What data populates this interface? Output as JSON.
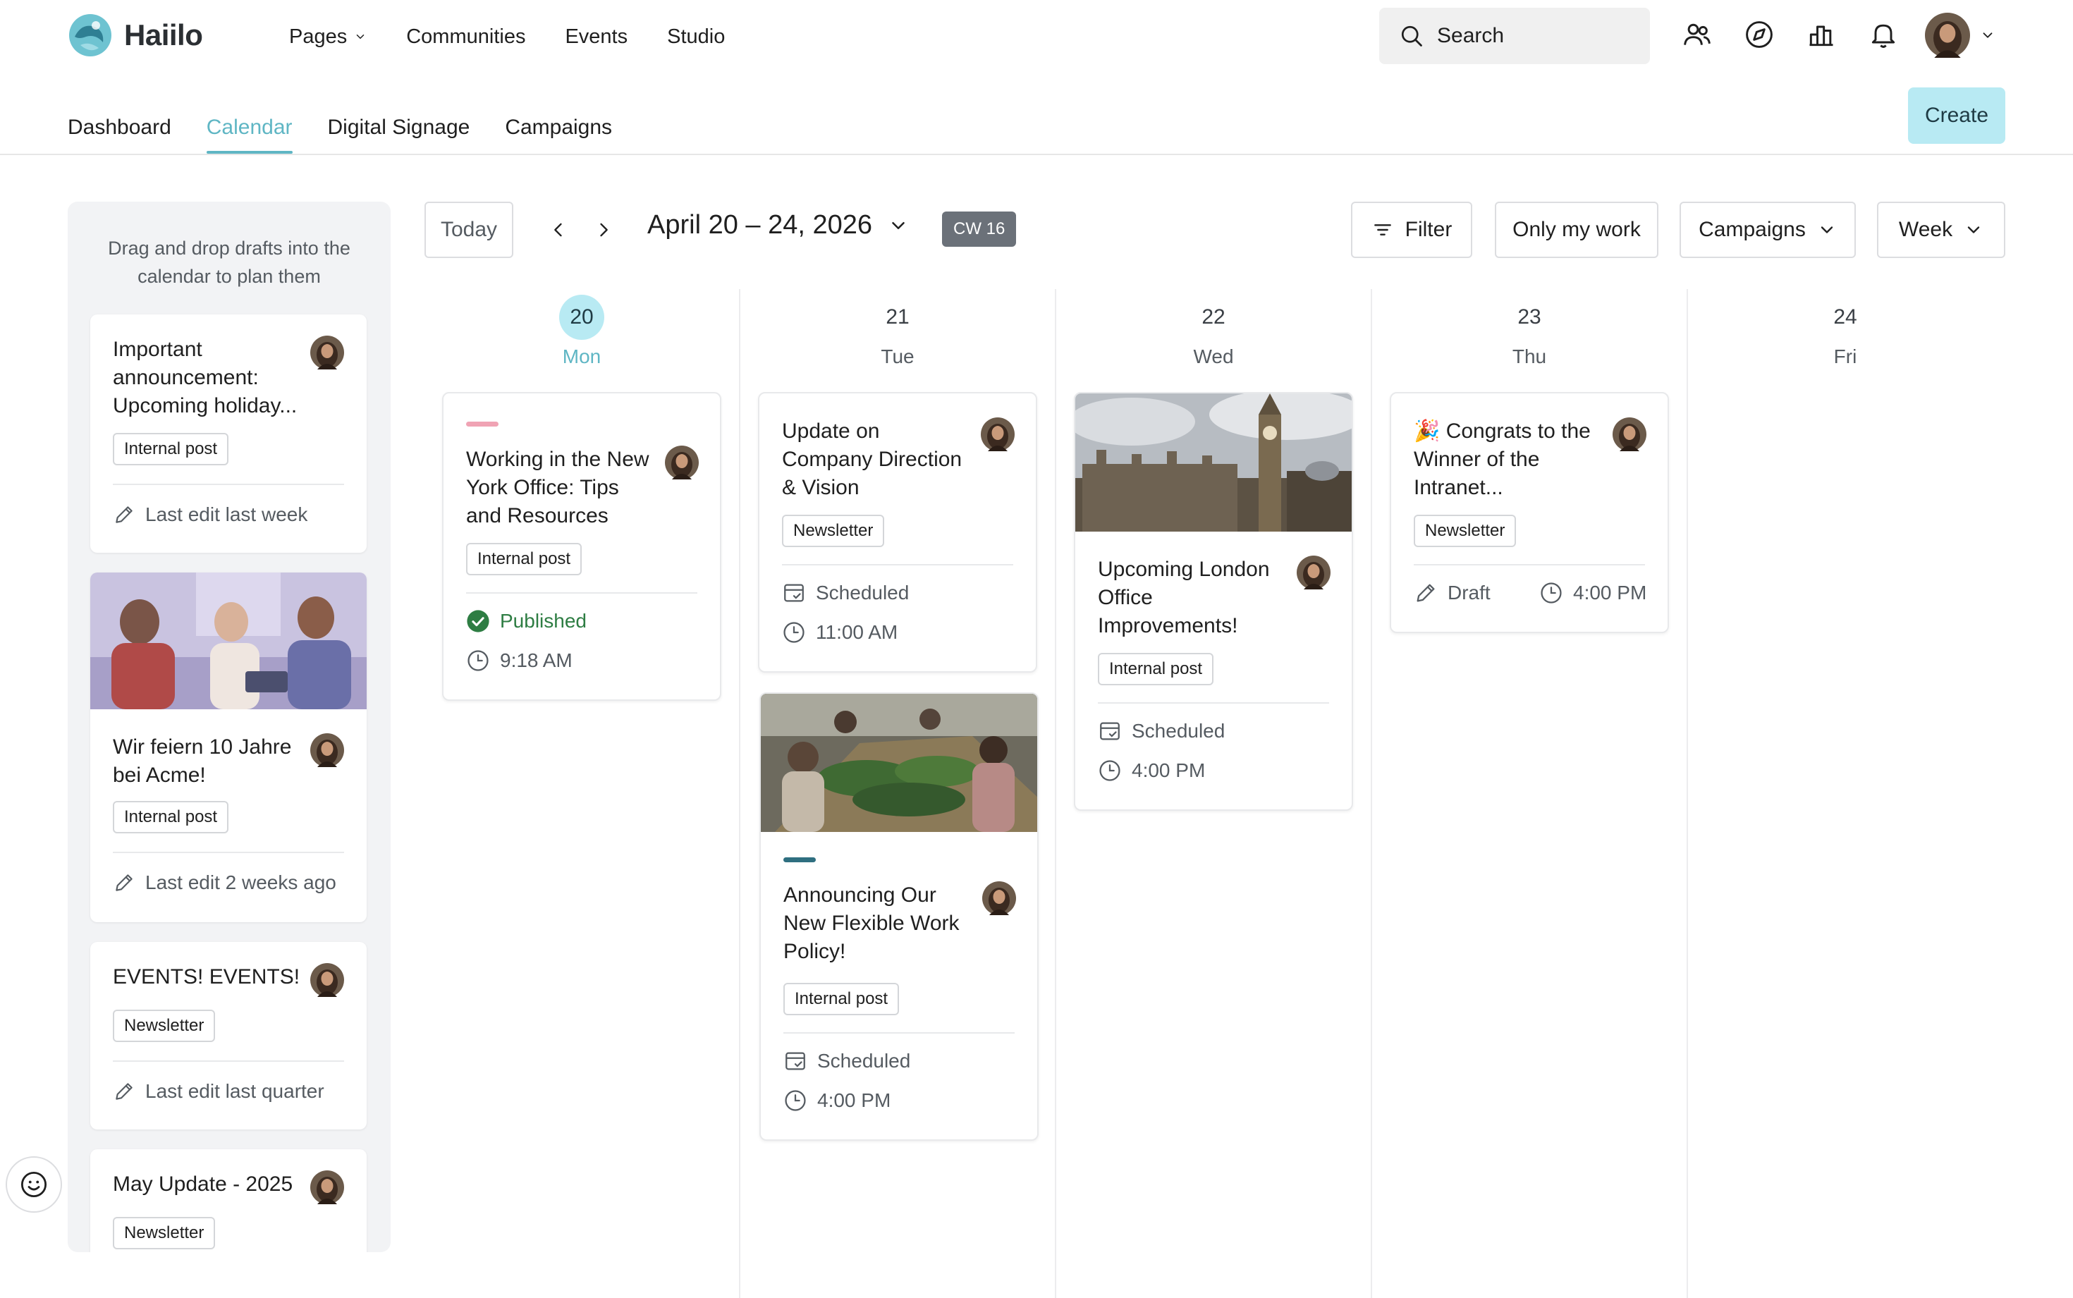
{
  "app": {
    "name": "Haiilo"
  },
  "main_nav": [
    {
      "label": "Pages",
      "has_dropdown": true
    },
    {
      "label": "Communities"
    },
    {
      "label": "Events"
    },
    {
      "label": "Studio"
    }
  ],
  "search": {
    "placeholder": "Search"
  },
  "top_icons": [
    "people-icon",
    "compass-icon",
    "analytics-icon",
    "bell-icon"
  ],
  "sub_nav": [
    {
      "label": "Dashboard",
      "active": false
    },
    {
      "label": "Calendar",
      "active": true
    },
    {
      "label": "Digital Signage",
      "active": false
    },
    {
      "label": "Campaigns",
      "active": false
    }
  ],
  "create_label": "Create",
  "sidebar": {
    "hint": "Drag and drop drafts into the calendar to plan them",
    "drafts": [
      {
        "title": "Important announcement: Upcoming holiday...",
        "tag": "Internal post",
        "meta": "Last edit last week"
      },
      {
        "title": "Wir feiern 10 Jahre bei Acme!",
        "tag": "Internal post",
        "meta": "Last edit 2 weeks ago"
      },
      {
        "title": "EVENTS! EVENTS!",
        "tag": "Newsletter",
        "meta": "Last edit last quarter"
      },
      {
        "title": "May Update - 2025",
        "tag": "Newsletter",
        "meta": ""
      }
    ]
  },
  "toolbar": {
    "today": "Today",
    "range": "April 20 – 24, 2026",
    "week_badge": "CW 16",
    "filter": "Filter",
    "only_mine": "Only my work",
    "campaigns": "Campaigns",
    "view": "Week"
  },
  "days": [
    {
      "num": "20",
      "name": "Mon",
      "today": true
    },
    {
      "num": "21",
      "name": "Tue",
      "today": false
    },
    {
      "num": "22",
      "name": "Wed",
      "today": false
    },
    {
      "num": "23",
      "name": "Thu",
      "today": false
    },
    {
      "num": "24",
      "name": "Fri",
      "today": false
    }
  ],
  "events": {
    "mon": {
      "title": "Working in the New York Office: Tips and Resources",
      "tag": "Internal post",
      "status": "Published",
      "time": "9:18 AM",
      "accent": "#f0a3b4"
    },
    "tue1": {
      "title": "Update on Company Direction & Vision",
      "tag": "Newsletter",
      "status": "Scheduled",
      "time": "11:00 AM"
    },
    "tue2": {
      "title": "Announcing Our New Flexible Work Policy!",
      "tag": "Internal post",
      "status": "Scheduled",
      "time": "4:00 PM",
      "accent": "#2f6f80"
    },
    "wed": {
      "title": "Upcoming London Office Improvements!",
      "tag": "Internal post",
      "status": "Scheduled",
      "time": "4:00 PM"
    },
    "thu": {
      "emoji": "🎉",
      "title": "Congrats to the Winner of the Intranet...",
      "tag": "Newsletter",
      "status": "Draft",
      "time": "4:00 PM"
    }
  },
  "colors": {
    "accent": "#5fb6c4",
    "create_bg": "#b8eaf3",
    "published": "#2e7d43"
  }
}
